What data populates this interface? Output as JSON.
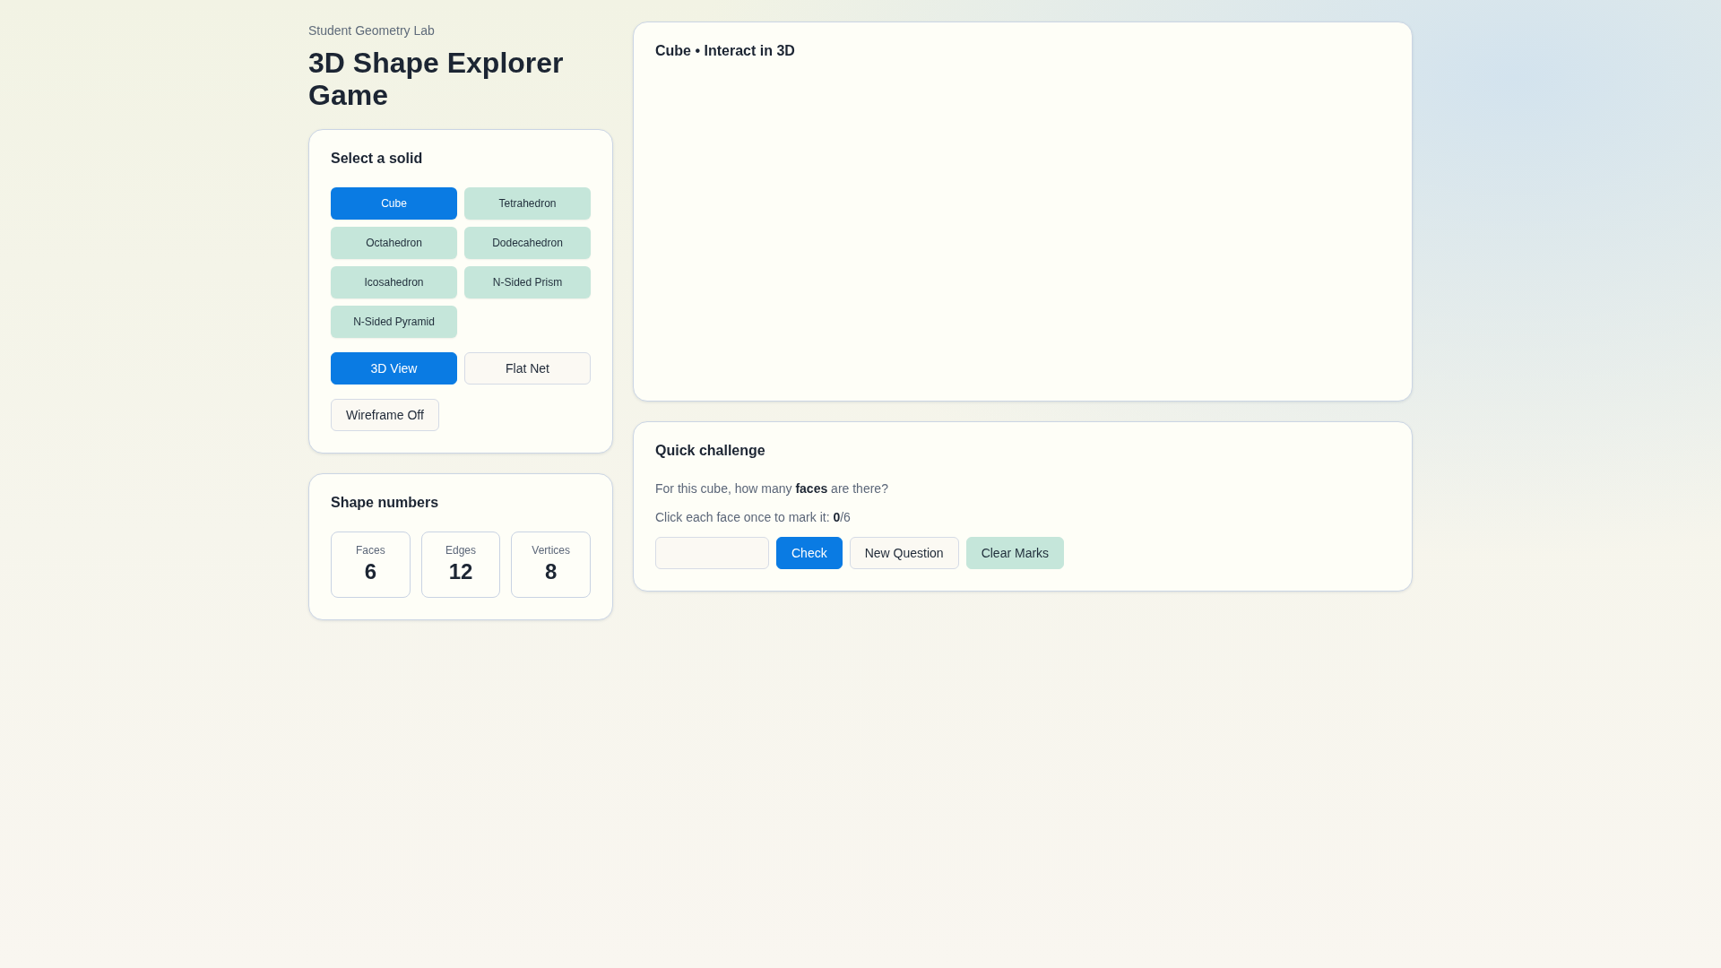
{
  "header": {
    "eyebrow": "Student Geometry Lab",
    "title": "3D Shape Explorer Game"
  },
  "solid_picker": {
    "title": "Select a solid",
    "solids": [
      {
        "label": "Cube",
        "selected": true
      },
      {
        "label": "Tetrahedron",
        "selected": false
      },
      {
        "label": "Octahedron",
        "selected": false
      },
      {
        "label": "Dodecahedron",
        "selected": false
      },
      {
        "label": "Icosahedron",
        "selected": false
      },
      {
        "label": "N-Sided Prism",
        "selected": false
      },
      {
        "label": "N-Sided Pyramid",
        "selected": false
      }
    ],
    "views": [
      {
        "label": "3D View",
        "selected": true
      },
      {
        "label": "Flat Net",
        "selected": false
      }
    ],
    "wireframe_button": {
      "label": "Wireframe Off"
    }
  },
  "shape_numbers": {
    "title": "Shape numbers",
    "stats": [
      {
        "label": "Faces",
        "value": "6"
      },
      {
        "label": "Edges",
        "value": "12"
      },
      {
        "label": "Vertices",
        "value": "8"
      }
    ]
  },
  "viewer": {
    "title": "Cube • Interact in 3D"
  },
  "challenge": {
    "title": "Quick challenge",
    "question": "For this cube, how many **faces** are there?",
    "progress": "Click each face once to mark it: **0**/6",
    "buttons": [
      {
        "label": "Check",
        "kind": "primary"
      },
      {
        "label": "New Question",
        "kind": "outline"
      },
      {
        "label": "Clear Marks",
        "kind": "soft"
      }
    ]
  }
}
